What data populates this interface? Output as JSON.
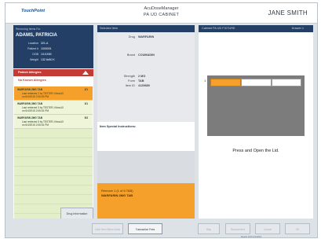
{
  "app": {
    "logo": "TouchPoint",
    "name": "AcuDoseManager",
    "subtitle": "PA UD CABINET",
    "user": "JANE SMITH"
  },
  "patient": {
    "header": "Removing Items For",
    "name": "ADAMS, PATRICIA",
    "fields": [
      {
        "label": "Location",
        "value": "321-A"
      },
      {
        "label": "Patient #",
        "value": "1000001"
      },
      {
        "label": "DOB",
        "value": "1/1/1930"
      },
      {
        "label": "Weight",
        "value": "132 lb/60 K"
      }
    ],
    "allergies_label": "Patient Allergies",
    "no_allergies": "No Known Allergies"
  },
  "list": {
    "items": [
      {
        "name": "WARFARIN 2MG TAB",
        "count": "2/1",
        "detail1": "Last retrieved 2 by TESTER, Kfoss10",
        "detail2": "on 6/4/2015 2:06:53 PM"
      },
      {
        "name": "WARFARIN 2MG TAB",
        "count": "3/1",
        "detail1": "Last retrieved 3 by TESTER, Kfoss10",
        "detail2": "on 6/4/2015 2:06:51 PM"
      },
      {
        "name": "WARFARIN 2MG TAB",
        "count": "5/3",
        "detail1": "Last retrieved 5 by TESTER, Kfoss10",
        "detail2": "on 6/4/2015 2:06:51 PM"
      }
    ],
    "drug_info_button": "Drug Information"
  },
  "selected": {
    "header": "Selected Item",
    "fields": [
      {
        "label": "Drug",
        "value": "WARFARIN"
      },
      {
        "label": "Brand",
        "value": "COUMADIN"
      },
      {
        "label": "Strength",
        "value": "2 MG"
      },
      {
        "label": "Form",
        "value": "TAB"
      },
      {
        "label": "Item ID",
        "value": "4125689"
      }
    ],
    "instructions_label": "Item Special Instructions:",
    "remove_line1": "Remove 1 (1 of 6 TAB)",
    "remove_line2": "WARFARIN 2MG TAB"
  },
  "cabinet": {
    "title": "Cabinet PA UD FIXTURE",
    "drawer": "Drawer 1",
    "marker": "1",
    "instruction": "Press and Open the Lid."
  },
  "bottom": {
    "buttons": [
      {
        "label": "Click Here When Done",
        "active": false
      },
      {
        "label": "Transaction Fees",
        "active": true
      },
      {
        "label": "Skip",
        "active": false
      },
      {
        "label": "Recommend",
        "active": false
      },
      {
        "label": "Cancel",
        "active": false
      },
      {
        "label": "OK",
        "active": false
      }
    ],
    "status": "Ready  ANS  6/4/2015"
  },
  "colors": {
    "navy": "#243f66",
    "orange": "#f5a02a",
    "red": "#c43a34",
    "green_light": "#eef5d9"
  }
}
